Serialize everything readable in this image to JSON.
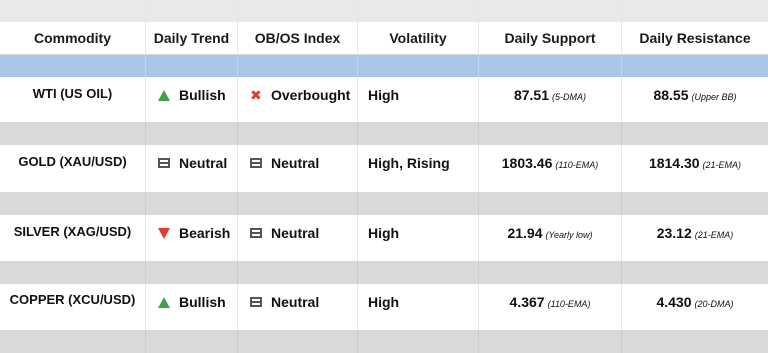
{
  "headers": [
    "Commodity",
    "Daily Trend",
    "OB/OS Index",
    "Volatility",
    "Daily Support",
    "Daily Resistance"
  ],
  "rows": [
    {
      "commodity": "WTI (US OIL)",
      "trend": {
        "icon": "triangle-up-green-icon",
        "label": "Bullish"
      },
      "obos": {
        "icon": "x-mark-red-icon",
        "label": "Overbought"
      },
      "volatility": "High",
      "support": {
        "value": "87.51",
        "note": "(5-DMA)"
      },
      "resistance": {
        "value": "88.55",
        "note": "(Upper BB)"
      }
    },
    {
      "commodity": "GOLD (XAU/USD)",
      "trend": {
        "icon": "neutral-bars-icon",
        "label": "Neutral"
      },
      "obos": {
        "icon": "neutral-bars-icon",
        "label": "Neutral"
      },
      "volatility": "High, Rising",
      "support": {
        "value": "1803.46",
        "note": "(110-EMA)"
      },
      "resistance": {
        "value": "1814.30",
        "note": "(21-EMA)"
      }
    },
    {
      "commodity": "SILVER (XAG/USD)",
      "trend": {
        "icon": "triangle-down-red-icon",
        "label": "Bearish"
      },
      "obos": {
        "icon": "neutral-bars-icon",
        "label": "Neutral"
      },
      "volatility": "High",
      "support": {
        "value": "21.94",
        "note": "(Yearly low)"
      },
      "resistance": {
        "value": "23.12",
        "note": "(21-EMA)"
      }
    },
    {
      "commodity": "COPPER (XCU/USD)",
      "trend": {
        "icon": "triangle-up-green-icon",
        "label": "Bullish"
      },
      "obos": {
        "icon": "neutral-bars-icon",
        "label": "Neutral"
      },
      "volatility": "High",
      "support": {
        "value": "4.367",
        "note": "(110-EMA)"
      },
      "resistance": {
        "value": "4.430",
        "note": "(20-DMA)"
      }
    }
  ],
  "colors": {
    "header_band": "#e9e9e9",
    "accent_band": "#a8c7ea",
    "gray_band": "#d9d9d9",
    "bullish": "#43a047",
    "bearish": "#e53935",
    "overbought": "#e53935",
    "neutral_icon": "#555555"
  }
}
